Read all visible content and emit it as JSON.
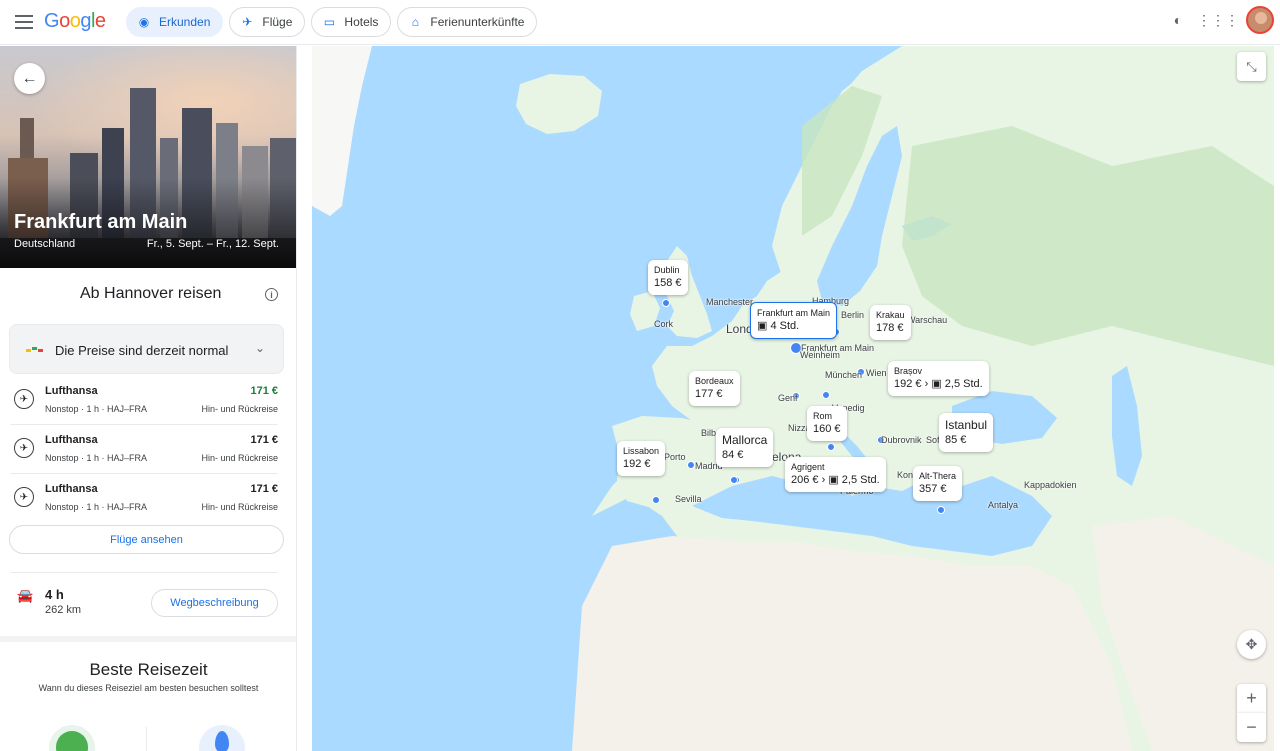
{
  "header": {
    "logo": {
      "g1": "G",
      "o1": "o",
      "o2": "o",
      "g2": "g",
      "l": "l",
      "e": "e"
    },
    "tabs": [
      {
        "label": "Erkunden",
        "icon": "explore-icon",
        "active": true
      },
      {
        "label": "Flüge",
        "icon": "flight-icon",
        "active": false
      },
      {
        "label": "Hotels",
        "icon": "hotel-icon",
        "active": false
      },
      {
        "label": "Ferienunterkünfte",
        "icon": "home-icon",
        "active": false
      }
    ],
    "right_icons": [
      "dark-mode-icon",
      "apps-grid-icon",
      "account-avatar"
    ]
  },
  "destination": {
    "title": "Frankfurt am Main",
    "country": "Deutschland",
    "dates": "Fr., 5. Sept. – Fr., 12. Sept."
  },
  "travel": {
    "from_title": "Ab Hannover reisen",
    "price_status": "Die Preise sind derzeit normal",
    "flights": [
      {
        "airline": "Lufthansa",
        "details": "Nonstop · 1 h · HAJ–FRA",
        "price": "171 €",
        "trip": "Hin- und Rückreise",
        "price_color": "#188038"
      },
      {
        "airline": "Lufthansa",
        "details": "Nonstop · 1 h · HAJ–FRA",
        "price": "171 €",
        "trip": "Hin- und Rückreise",
        "price_color": "#202124"
      },
      {
        "airline": "Lufthansa",
        "details": "Nonstop · 1 h · HAJ–FRA",
        "price": "171 €",
        "trip": "Hin- und Rückreise",
        "price_color": "#202124"
      }
    ],
    "flights_button": "Flüge ansehen",
    "drive": {
      "duration": "4 h",
      "distance": "262 km",
      "button": "Wegbeschreibung"
    }
  },
  "best_time": {
    "title": "Beste Reisezeit",
    "subtitle": "Wann du dieses Reiseziel am besten besuchen solltest"
  },
  "map": {
    "labels": [
      {
        "name": "Dublin",
        "price": "158 €"
      },
      {
        "name": "Frankfurt am Main",
        "price": "4 Std."
      },
      {
        "name": "Krakau",
        "price": "178 €"
      },
      {
        "name": "Brașov",
        "price": "192 €",
        "extra": "2,5 Std."
      },
      {
        "name": "Bordeaux",
        "price": "177 €"
      },
      {
        "name": "Rom",
        "price": "160 €"
      },
      {
        "name": "Istanbul",
        "price": "85 €"
      },
      {
        "name": "Mallorca",
        "price": "84 €"
      },
      {
        "name": "Lissabon",
        "price": "192 €"
      },
      {
        "name": "Agrigent",
        "price": "206 €",
        "extra": "2,5 Std."
      },
      {
        "name": "Alt-Thera",
        "price": "357 €"
      }
    ],
    "cities": [
      "Manchester",
      "Hamburg",
      "Berlin",
      "Warschau",
      "Cork",
      "Lond",
      "Frankfurt am Main",
      "Weinheim",
      "München",
      "Wien",
      "Genf",
      "Venedig",
      "Nizza",
      "Bilb",
      "Porto",
      "Madrid",
      "elona",
      "Sevilla",
      "Palermo",
      "Dubrovnik",
      "Sof",
      "Kon",
      "Kappadokien",
      "Antalya"
    ],
    "colors": {
      "water": "#aadaff",
      "land": "#e8f5e4",
      "forest": "#c8e6c0",
      "desert": "#f4f1ea",
      "pin": "#4285f4"
    }
  }
}
